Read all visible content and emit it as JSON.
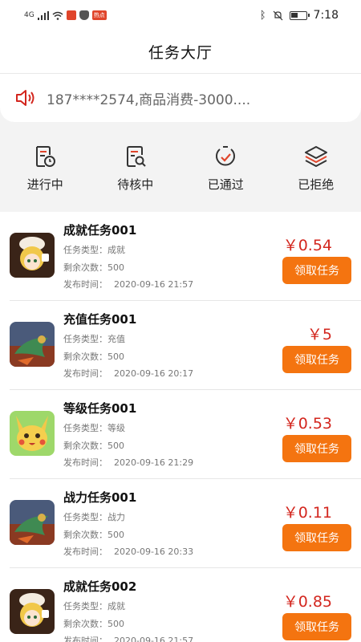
{
  "status_bar": {
    "network": "4G",
    "time": "7:18",
    "badge": "热点"
  },
  "header": {
    "title": "任务大厅"
  },
  "notice": {
    "text": "187****2574,商品消费-3000...."
  },
  "quick_nav": [
    {
      "label": "进行中",
      "icon": "document-clock-icon"
    },
    {
      "label": "待核中",
      "icon": "document-search-icon"
    },
    {
      "label": "已通过",
      "icon": "check-circle-icon"
    },
    {
      "label": "已拒绝",
      "icon": "layers-icon"
    }
  ],
  "labels": {
    "type": "任务类型：",
    "remaining": "剩余次数：",
    "published": "发布时间："
  },
  "tasks": [
    {
      "name": "成就任务001",
      "type": "成就",
      "remaining": "500",
      "published": "2020-09-16 21:57",
      "price": "￥0.54",
      "button": "领取任务",
      "thumb": "girl-character"
    },
    {
      "name": "充值任务001",
      "type": "充值",
      "remaining": "500",
      "published": "2020-09-16 20:17",
      "price": "￥5",
      "button": "领取任务",
      "thumb": "dragon-warrior"
    },
    {
      "name": "等级任务001",
      "type": "等级",
      "remaining": "500",
      "published": "2020-09-16 21:29",
      "price": "￥0.53",
      "button": "领取任务",
      "thumb": "yellow-creature"
    },
    {
      "name": "战力任务001",
      "type": "战力",
      "remaining": "500",
      "published": "2020-09-16 20:33",
      "price": "￥0.11",
      "button": "领取任务",
      "thumb": "dragon-warrior"
    },
    {
      "name": "成就任务002",
      "type": "成就",
      "remaining": "500",
      "published": "2020-09-16 21:57",
      "price": "￥0.85",
      "button": "领取任务",
      "thumb": "girl-character"
    }
  ],
  "colors": {
    "accent": "#f47410",
    "price": "#d3261e",
    "icon_red": "#e0452b"
  }
}
